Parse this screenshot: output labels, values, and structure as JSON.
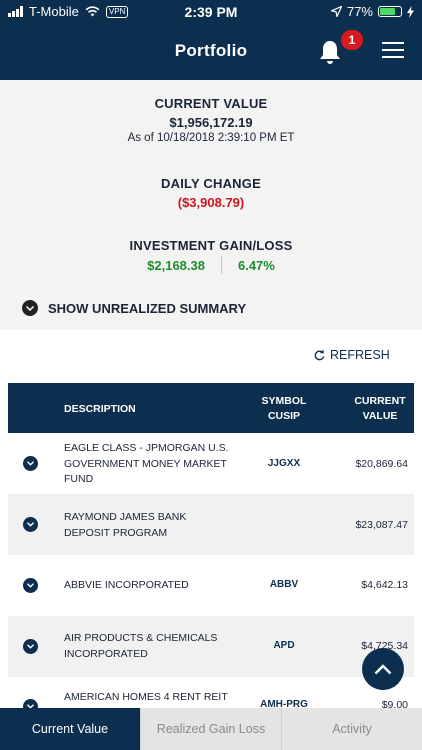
{
  "status_bar": {
    "carrier": "T-Mobile",
    "vpn": "VPN",
    "time": "2:39 PM",
    "battery": "77%",
    "battery_level": 0.77
  },
  "nav": {
    "title": "Portfolio",
    "notification_count": "1"
  },
  "summary": {
    "current_value_label": "CURRENT VALUE",
    "current_value": "$1,956,172.19",
    "as_of": "As of 10/18/2018 2:39:10 PM ET",
    "daily_change_label": "DAILY CHANGE",
    "daily_change": "($3,908.79)",
    "gain_loss_label": "INVESTMENT GAIN/LOSS",
    "gain_amount": "$2,168.38",
    "gain_percent": "6.47%",
    "show_unrealized": "SHOW UNREALIZED SUMMARY"
  },
  "refresh_label": "REFRESH",
  "table": {
    "col_description": "DESCRIPTION",
    "col_symbol_1": "SYMBOL",
    "col_symbol_2": "CUSIP",
    "col_value_1": "CURRENT",
    "col_value_2": "VALUE",
    "rows": [
      {
        "line1": "EAGLE CLASS - JPMORGAN U.S.",
        "line2": "GOVERNMENT MONEY MARKET",
        "line3": "FUND",
        "symbol": "JJGXX",
        "value": "$20,869.64"
      },
      {
        "line1": "RAYMOND JAMES BANK",
        "line2": "DEPOSIT PROGRAM",
        "line3": "",
        "symbol": "",
        "value": "$23,087.47"
      },
      {
        "line1": "ABBVIE INCORPORATED",
        "line2": "",
        "line3": "",
        "symbol": "ABBV",
        "value": "$4,642.13"
      },
      {
        "line1": "AIR PRODUCTS & CHEMICALS",
        "line2": "INCORPORATED",
        "line3": "",
        "symbol": "APD",
        "value": "$4,725.34"
      },
      {
        "line1": "AMERICAN HOMES 4 RENT REIT",
        "line2": "",
        "line3": "",
        "symbol": "AMH-PRG",
        "value": "$9,00"
      }
    ]
  },
  "tabs": {
    "current_value": "Current Value",
    "realized": "Realized Gain Loss",
    "activity": "Activity"
  }
}
